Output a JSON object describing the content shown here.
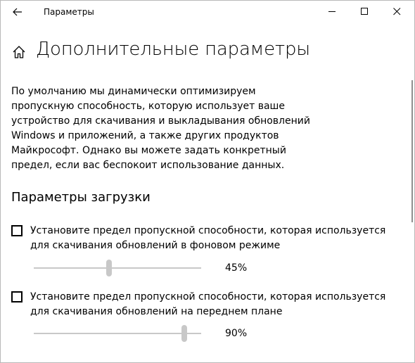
{
  "window": {
    "title": "Параметры"
  },
  "page": {
    "title": "Дополнительные параметры",
    "description": "По умолчанию мы динамически оптимизируем пропускную способность, которую использует ваше устройство для скачивания и выкладывания обновлений Windows и приложений, а также других продуктов Майкрософт. Однако вы можете задать конкретный предел, если вас беспокоит использование данных."
  },
  "download_settings": {
    "title": "Параметры загрузки",
    "background": {
      "label": "Установите предел пропускной способности, которая используется для скачивания обновлений в фоновом режиме",
      "checked": false,
      "value_label": "45%",
      "value": 45
    },
    "foreground": {
      "label": "Установите предел пропускной способности, которая используется для скачивания обновлений на переднем плане",
      "checked": false,
      "value_label": "90%",
      "value": 90
    }
  },
  "icons": {
    "back": "back-arrow-icon",
    "minimize": "minimize-icon",
    "maximize": "maximize-icon",
    "close": "close-icon",
    "home": "home-icon"
  },
  "colors": {
    "slider_inactive": "#c8c8c8",
    "scrollbar": "#8f8f8f"
  }
}
